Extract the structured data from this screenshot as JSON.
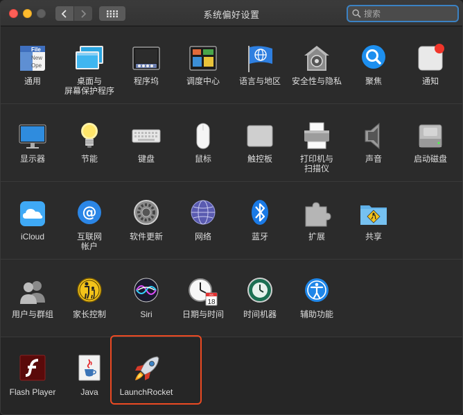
{
  "window": {
    "title": "系统偏好设置",
    "search_placeholder": "搜索"
  },
  "rows": [
    [
      {
        "label": "通用",
        "icon": "general-icon",
        "file_badge": "File",
        "doc_lines": [
          "New",
          "Ope"
        ]
      },
      {
        "label": "桌面与\n屏幕保护程序",
        "icon": "desktop-screensaver-icon"
      },
      {
        "label": "程序坞",
        "icon": "dock-icon"
      },
      {
        "label": "调度中心",
        "icon": "mission-control-icon"
      },
      {
        "label": "语言与地区",
        "icon": "language-region-icon"
      },
      {
        "label": "安全性与隐私",
        "icon": "security-privacy-icon"
      },
      {
        "label": "聚焦",
        "icon": "spotlight-icon"
      },
      {
        "label": "通知",
        "icon": "notifications-icon"
      }
    ],
    [
      {
        "label": "显示器",
        "icon": "displays-icon"
      },
      {
        "label": "节能",
        "icon": "energy-saver-icon"
      },
      {
        "label": "键盘",
        "icon": "keyboard-icon"
      },
      {
        "label": "鼠标",
        "icon": "mouse-icon"
      },
      {
        "label": "触控板",
        "icon": "trackpad-icon"
      },
      {
        "label": "打印机与\n扫描仪",
        "icon": "printers-scanners-icon"
      },
      {
        "label": "声音",
        "icon": "sound-icon"
      },
      {
        "label": "启动磁盘",
        "icon": "startup-disk-icon"
      }
    ],
    [
      {
        "label": "iCloud",
        "icon": "icloud-icon"
      },
      {
        "label": "互联网\n帐户",
        "icon": "internet-accounts-icon"
      },
      {
        "label": "软件更新",
        "icon": "software-update-icon"
      },
      {
        "label": "网络",
        "icon": "network-icon"
      },
      {
        "label": "蓝牙",
        "icon": "bluetooth-icon"
      },
      {
        "label": "扩展",
        "icon": "extensions-icon"
      },
      {
        "label": "共享",
        "icon": "sharing-icon"
      }
    ],
    [
      {
        "label": "用户与群组",
        "icon": "users-groups-icon"
      },
      {
        "label": "家长控制",
        "icon": "parental-controls-icon"
      },
      {
        "label": "Siri",
        "icon": "siri-icon"
      },
      {
        "label": "日期与时间",
        "icon": "date-time-icon",
        "calendar_month": "JUL",
        "calendar_day": "18"
      },
      {
        "label": "时间机器",
        "icon": "time-machine-icon"
      },
      {
        "label": "辅助功能",
        "icon": "accessibility-icon"
      }
    ],
    [
      {
        "label": "Flash Player",
        "icon": "flash-player-icon"
      },
      {
        "label": "Java",
        "icon": "java-icon"
      },
      {
        "label": "LaunchRocket",
        "icon": "launchrocket-icon"
      }
    ]
  ],
  "colors": {
    "close": "#fe5f57",
    "minimize": "#febc2e",
    "highlight": "#ec4a22",
    "search_focus": "#3b82c4"
  }
}
